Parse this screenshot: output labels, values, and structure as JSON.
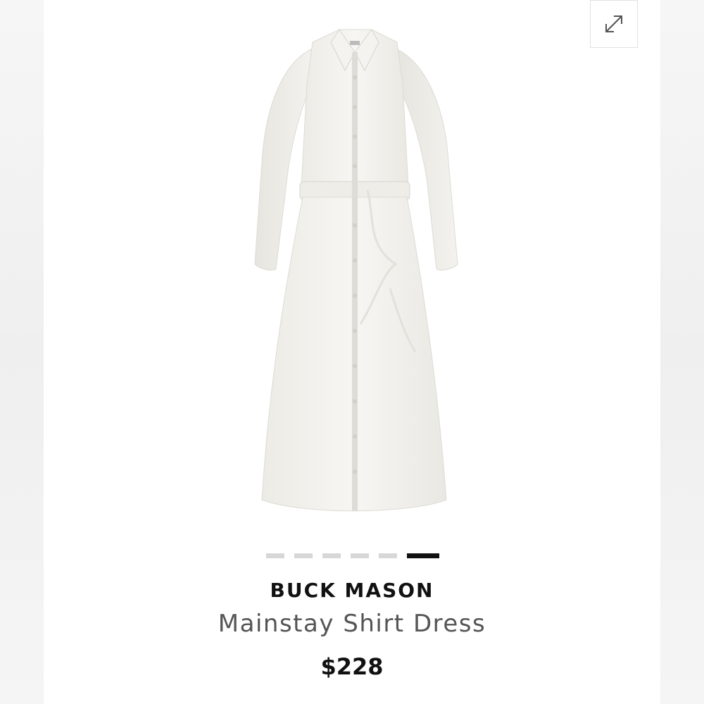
{
  "product": {
    "brand": "BUCK MASON",
    "name": "Mainstay Shirt Dress",
    "price": "$228",
    "image_icon": "white-shirt-dress-image"
  },
  "gallery": {
    "total_images": 6,
    "active_index": 6,
    "expand_icon": "expand-arrows-icon"
  },
  "colors": {
    "page_background": "#f3f3f3",
    "card_background": "#ffffff",
    "dot_inactive": "#d7d7d7",
    "dot_active": "#111111",
    "brand_text": "#111111",
    "title_text": "#555555",
    "price_text": "#111111"
  }
}
